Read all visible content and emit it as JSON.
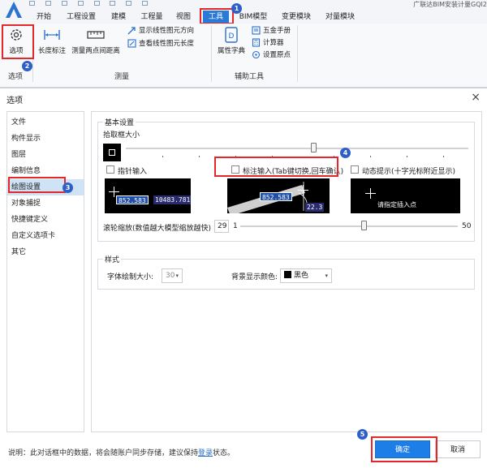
{
  "app": {
    "title": "广联达BIM安装计量GQI2"
  },
  "menu": {
    "tabs": [
      "开始",
      "工程设置",
      "建模",
      "工程量",
      "视图",
      "工具",
      "BIM模型",
      "变更模块",
      "对量模块"
    ],
    "active": "工具"
  },
  "ribbon": {
    "options_button": "选项",
    "options_group": "选项",
    "length_button": "长度标注",
    "measure_button": "测量两点间距离",
    "show_direction": "显示线性图元方向",
    "view_length": "查看线性图元长度",
    "measure_group": "测量",
    "attribute_dict": "属性字典",
    "hardware_manual": "五金手册",
    "calculator": "计算器",
    "set_origin": "设置原点",
    "aux_group": "辅助工具"
  },
  "badges": [
    "1",
    "2",
    "3",
    "4",
    "5"
  ],
  "dialog": {
    "title": "选项",
    "close": "×",
    "nav": [
      "文件",
      "构件显示",
      "图层",
      "编制信息",
      "绘图设置",
      "对象捕捉",
      "快捷键定义",
      "自定义选项卡",
      "其它"
    ],
    "nav_selected": "绘图设置",
    "basic_settings": {
      "label": "基本设置",
      "pick_box_label": "拾取框大小",
      "pick_box_level": 0.55,
      "pointer_input": "指针输入",
      "dimension_input": "标注输入(Tab键切换,回车确认)",
      "dynamic_hint": "动态提示(十字光标附近显示)",
      "pointer_preview": {
        "coord_x": "852.583",
        "coord_y": "10483.781"
      },
      "dimension_preview": {
        "length": "852.583",
        "angle": "22.3"
      },
      "dynamic_preview": {
        "text": "请指定插入点"
      },
      "scroll_zoom_label": "滚轮缩放(数值越大模型缩放越快)",
      "scroll_zoom_value": "29",
      "scroll_min": "1",
      "scroll_max": "50"
    },
    "style": {
      "label": "样式",
      "font_size_label": "字体绘制大小:",
      "font_size_value": "30",
      "bg_color_label": "背景显示颜色:",
      "bg_color_value": "黑色",
      "bg_color_swatch": "#000000"
    },
    "footer": {
      "note_prefix": "说明：此对话框中的数据，将会随账户同步存储，建议保持",
      "note_link": "登录",
      "note_suffix": "状态。"
    },
    "ok": "确定",
    "cancel": "取消"
  },
  "colors": {
    "accent": "#1e7ee8",
    "highlight": "#e5262b",
    "badge": "#2e5fc9",
    "nav_selected": "#cfe3f7"
  }
}
